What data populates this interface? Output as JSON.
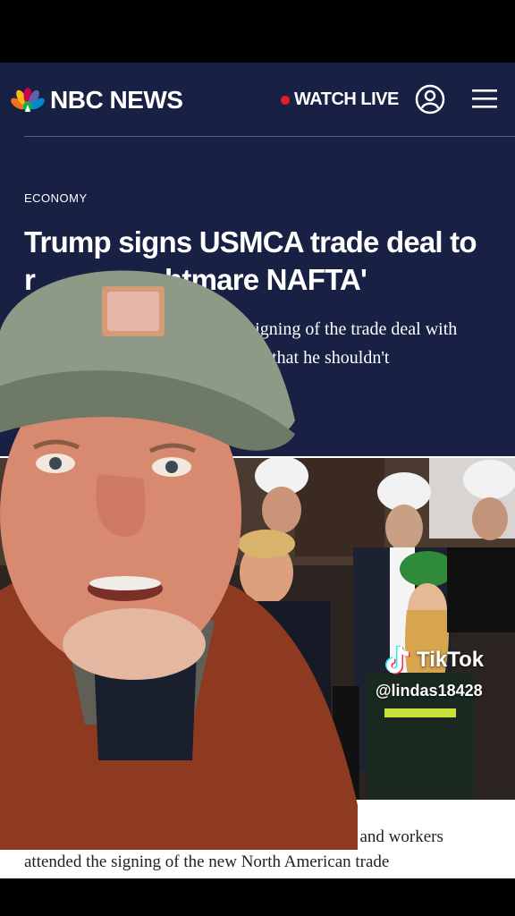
{
  "brand": {
    "logo_text": "NBC NEWS"
  },
  "header": {
    "watch_live": "WATCH LIVE"
  },
  "article": {
    "section": "ECONOMY",
    "headline_line1": "Trump signs USMCA trade deal to",
    "headline_line2_visible": "htmare NAFTA'",
    "headline_line2_left": "r",
    "dek_line1": "the signing of the trade deal with",
    "dek_line2": "joking that he shouldn't",
    "caption_line1_visible": "iding farmers, CEOs and workers",
    "caption_line2": "attended the signing of the new North American trade"
  },
  "overlay": {
    "app_name": "TikTok",
    "handle": "@lindas18428"
  },
  "colors": {
    "header_bg": "#182143",
    "live_dot": "#e4201f"
  }
}
